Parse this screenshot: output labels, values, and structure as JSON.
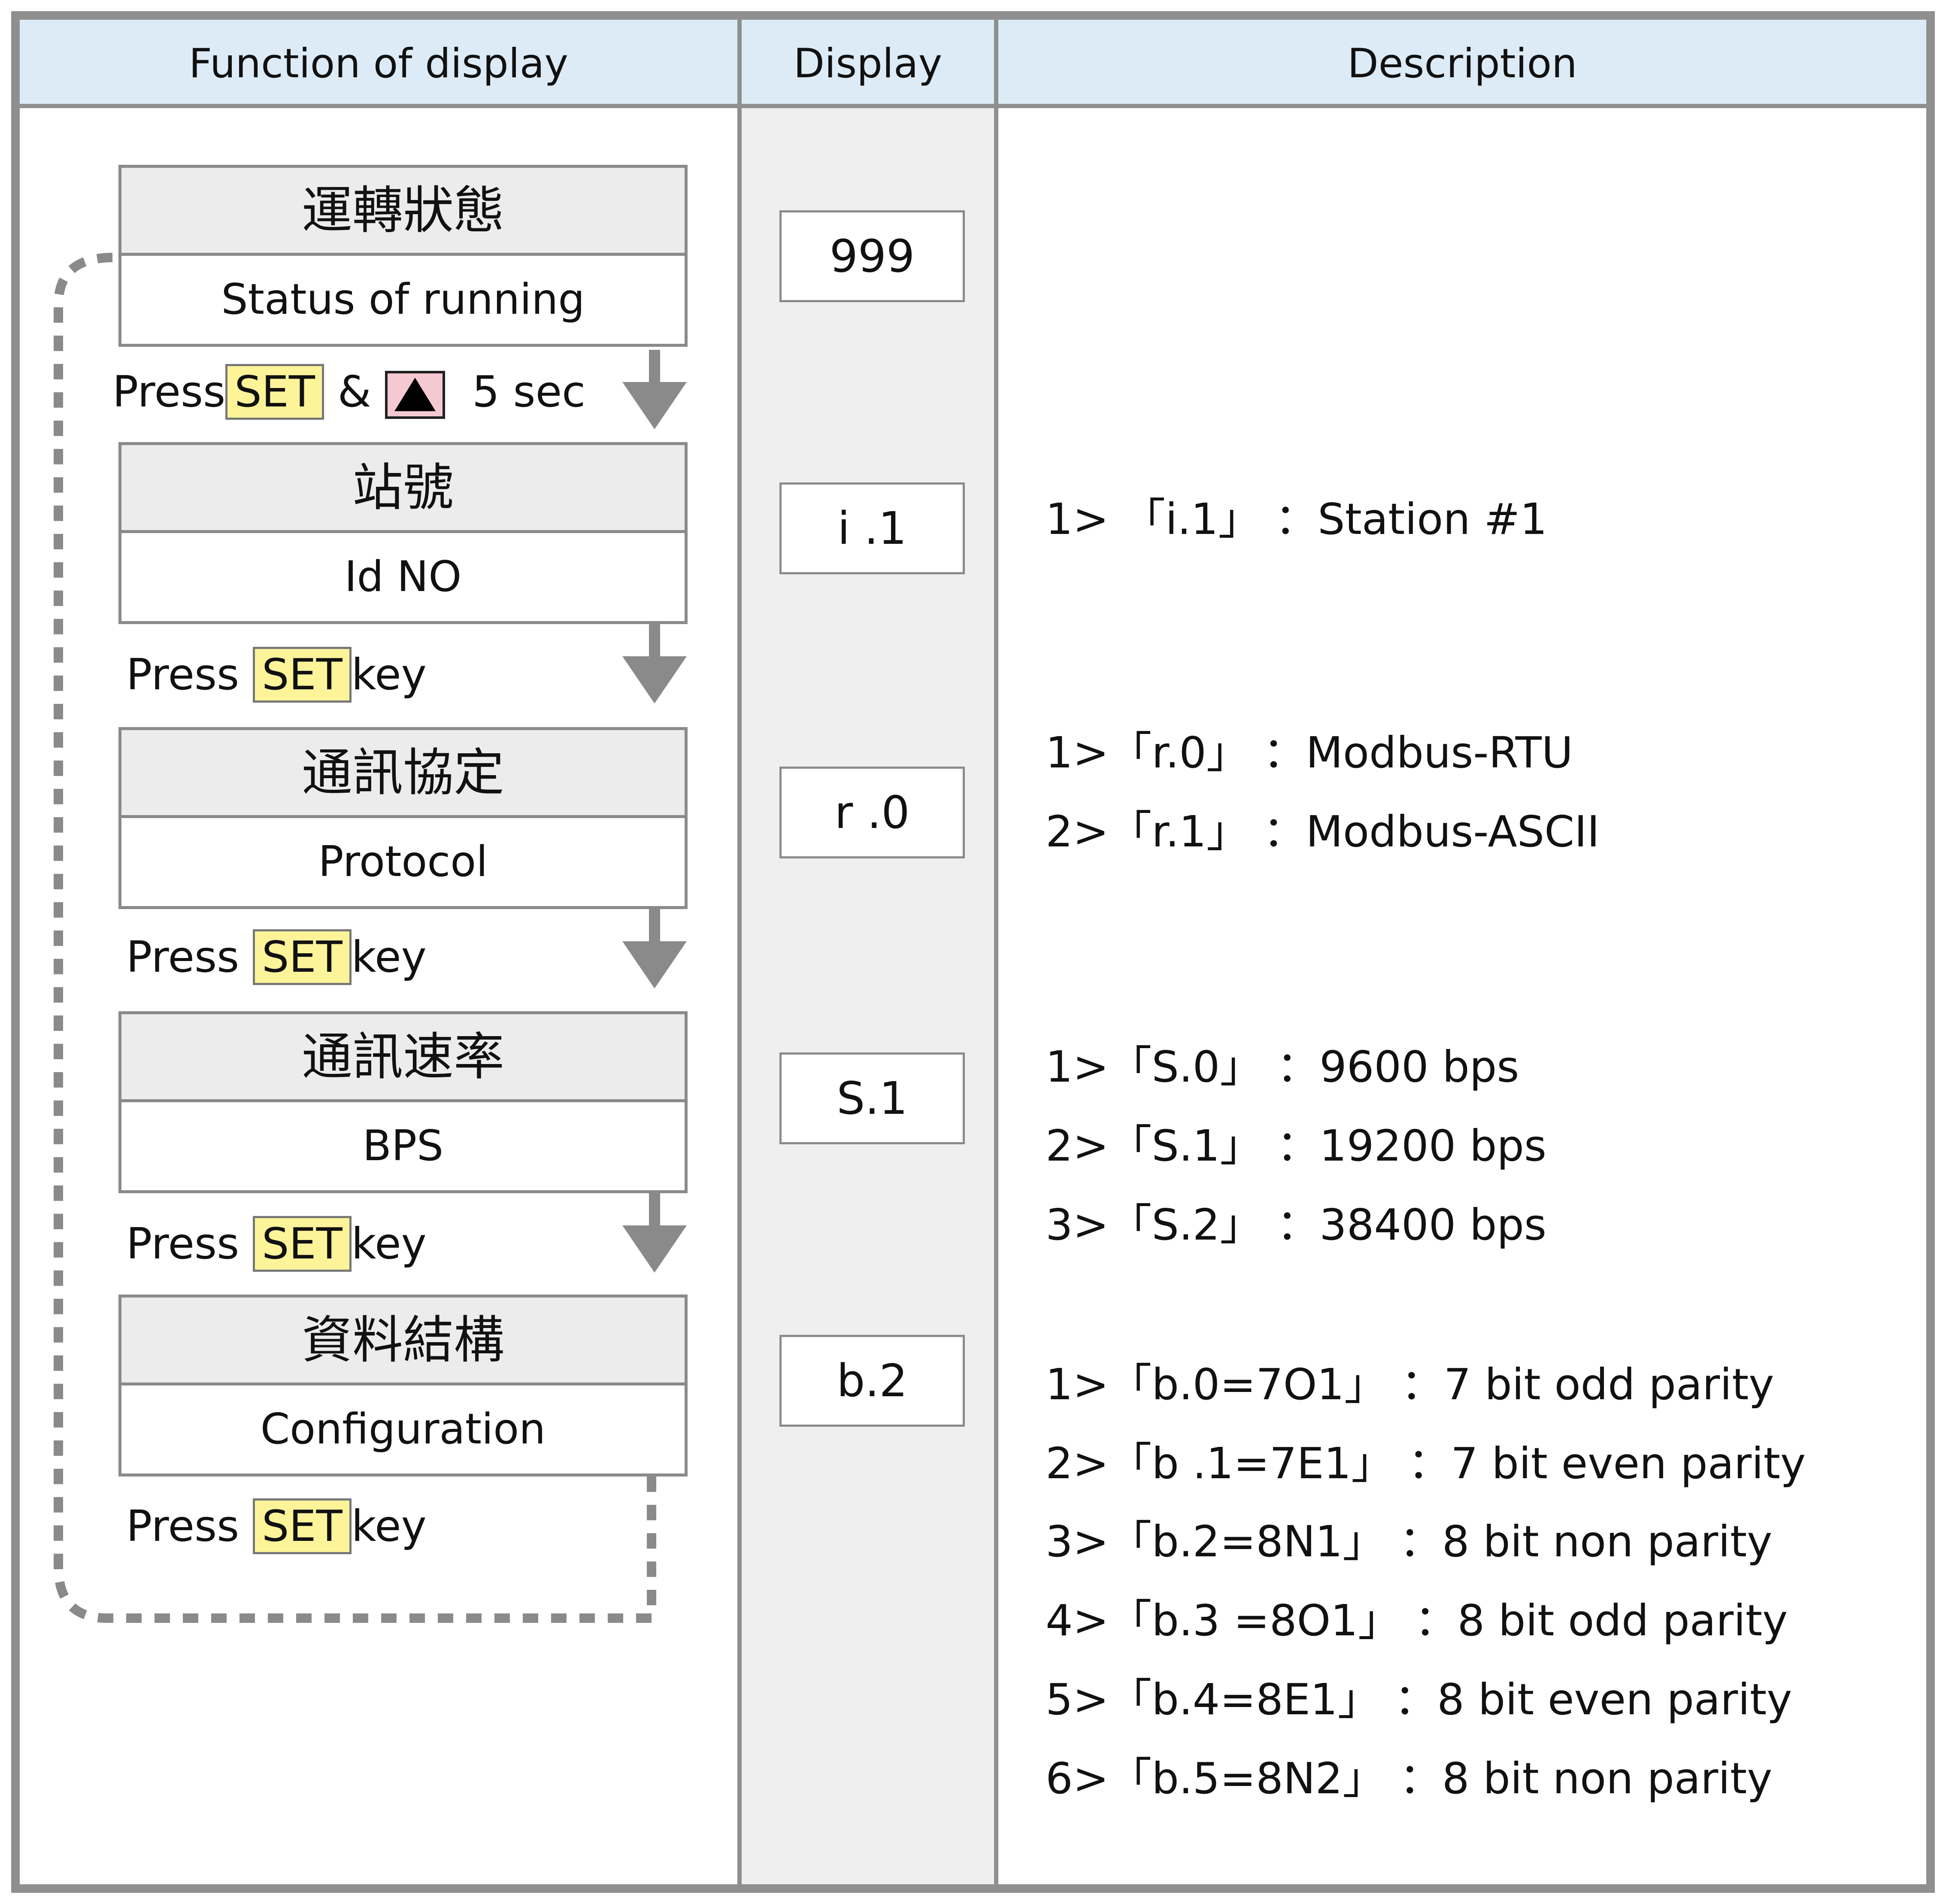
{
  "headers": {
    "function": "Function of display",
    "display": "Display",
    "description": "Description"
  },
  "steps": [
    {
      "zh": "運轉狀態",
      "en": "Status of running",
      "display": "999"
    },
    {
      "zh": "站號",
      "en": "Id NO",
      "display": "i .1"
    },
    {
      "zh": "通訊協定",
      "en": "Protocol",
      "display": "r .0"
    },
    {
      "zh": "通訊速率",
      "en": "BPS",
      "display": "S.1"
    },
    {
      "zh": "資料結構",
      "en": "Configuration",
      "display": "b.2"
    }
  ],
  "first_press": {
    "press": "Press",
    "key": "SET",
    "amp": "&",
    "key_icon": "up-triangle-icon",
    "duration": "5 sec"
  },
  "press_key": {
    "press": "Press",
    "key": "SET",
    "suffix": "key"
  },
  "descriptions": {
    "station": [
      "1> 「i.1」 ：Station #1"
    ],
    "protocol": [
      "1>「r.0」 ：Modbus-RTU",
      "2>「r.1」 ：Modbus-ASCII"
    ],
    "bps": [
      "1>「S.0」 ：9600 bps",
      "2>「S.1」 ：19200 bps",
      "3>「S.2」 ：38400 bps"
    ],
    "config": [
      "1>「b.0=7O1」 ：7 bit odd parity",
      "2>「b .1=7E1」 ：7 bit even parity",
      "3>「b.2=8N1」 ：8 bit non parity",
      "4>「b.3 =8O1」 ：8 bit odd parity",
      "5>「b.4=8E1」 ：8 bit even parity",
      "6>「b.5=8N2」 ：8 bit non parity"
    ]
  },
  "colors": {
    "header_bg": "#dcebf6",
    "set_key_bg": "#fdf49a",
    "up_key_bg": "#f4c9d2",
    "display_col_bg": "#efefef",
    "border": "#8f8f8f"
  }
}
